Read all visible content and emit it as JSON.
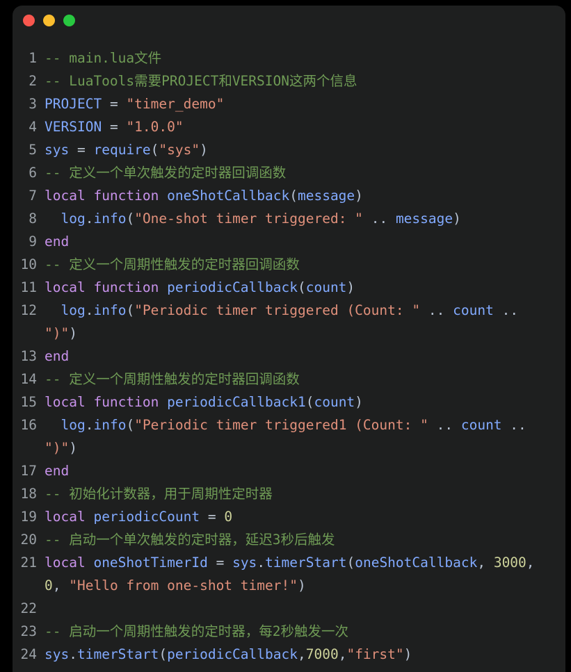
{
  "window": {
    "title": "",
    "traffic_lights": [
      {
        "name": "close",
        "color": "#f9574e"
      },
      {
        "name": "minimize",
        "color": "#fbbd2e"
      },
      {
        "name": "maximize",
        "color": "#28c840"
      }
    ]
  },
  "editor": {
    "language": "lua",
    "theme": "dark",
    "lines": [
      {
        "number": "1",
        "text": "-- main.lua文件"
      },
      {
        "number": "2",
        "text": "-- LuaTools需要PROJECT和VERSION这两个信息"
      },
      {
        "number": "3",
        "text": "PROJECT = \"timer_demo\""
      },
      {
        "number": "4",
        "text": "VERSION = \"1.0.0\""
      },
      {
        "number": "5",
        "text": "sys = require(\"sys\")"
      },
      {
        "number": "6",
        "text": "-- 定义一个单次触发的定时器回调函数"
      },
      {
        "number": "7",
        "text": "local function oneShotCallback(message)"
      },
      {
        "number": "8",
        "text": "  log.info(\"One-shot timer triggered: \" .. message)"
      },
      {
        "number": "9",
        "text": "end"
      },
      {
        "number": "10",
        "text": "-- 定义一个周期性触发的定时器回调函数"
      },
      {
        "number": "11",
        "text": "local function periodicCallback(count)"
      },
      {
        "number": "12",
        "text": "  log.info(\"Periodic timer triggered (Count: \" .. count .. \")\")"
      },
      {
        "number": "13",
        "text": "end"
      },
      {
        "number": "14",
        "text": "-- 定义一个周期性触发的定时器回调函数"
      },
      {
        "number": "15",
        "text": "local function periodicCallback1(count)"
      },
      {
        "number": "16",
        "text": "  log.info(\"Periodic timer triggered1 (Count: \" .. count .. \")\")"
      },
      {
        "number": "17",
        "text": "end"
      },
      {
        "number": "18",
        "text": "-- 初始化计数器，用于周期性定时器"
      },
      {
        "number": "19",
        "text": "local periodicCount = 0"
      },
      {
        "number": "20",
        "text": "-- 启动一个单次触发的定时器，延迟3秒后触发"
      },
      {
        "number": "21",
        "text": "local oneShotTimerId = sys.timerStart(oneShotCallback, 3000, 0, \"Hello from one-shot timer!\")"
      },
      {
        "number": "22",
        "text": ""
      },
      {
        "number": "23",
        "text": "-- 启动一个周期性触发的定时器，每2秒触发一次"
      },
      {
        "number": "24",
        "text": "sys.timerStart(periodicCallback,7000,\"first\")"
      }
    ]
  },
  "colors": {
    "background": "#000000",
    "panel": "#1e1f1f",
    "line_number": "#9aa0a6",
    "comment": "#6f9b55",
    "keyword": "#c792ea",
    "variable": "#82aaff",
    "string": "#e0907b",
    "number": "#cdd29a",
    "punctuation": "#b9c4d4",
    "default_text": "#d6deeb"
  }
}
